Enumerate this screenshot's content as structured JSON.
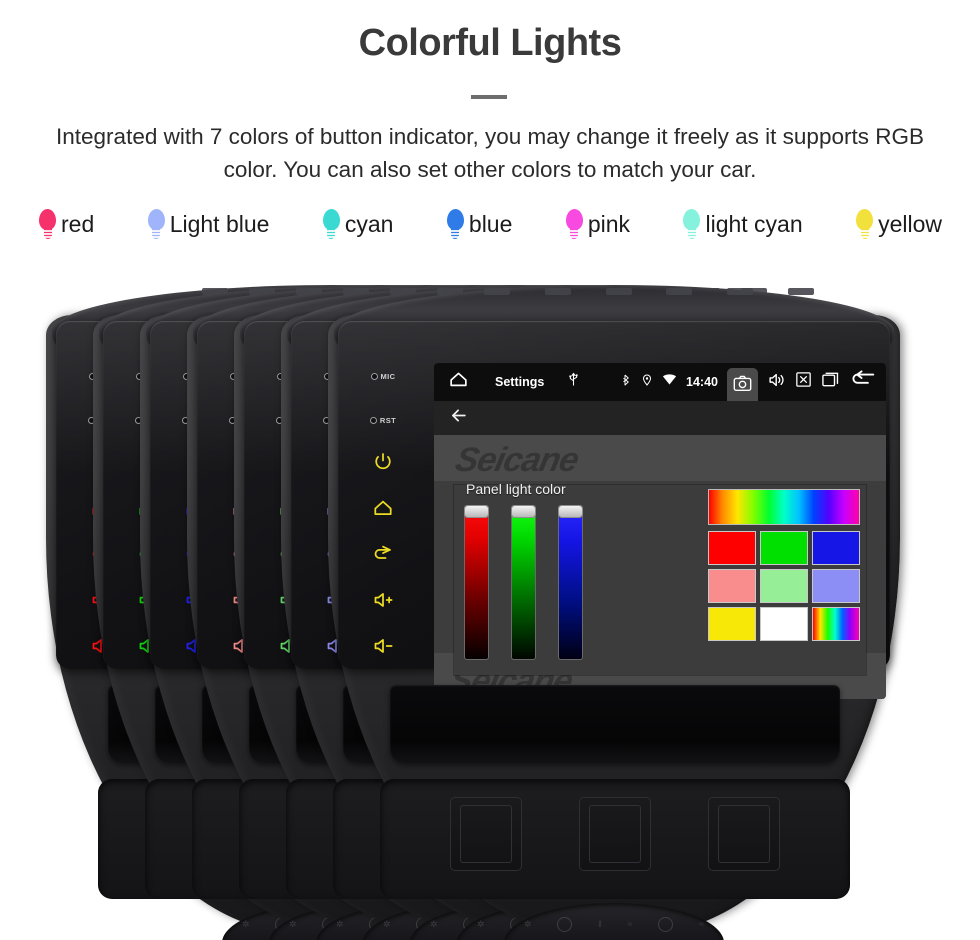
{
  "header": {
    "title": "Colorful Lights",
    "subtitle": "Integrated with 7 colors of button indicator, you may change it freely as it supports RGB color. You can also set other colors to match your car."
  },
  "legend": {
    "items": [
      {
        "label": "red",
        "icon": "bulb-icon",
        "color": "#f5326b"
      },
      {
        "label": "Light blue",
        "icon": "bulb-icon",
        "color": "#9fb4fb"
      },
      {
        "label": "cyan",
        "icon": "bulb-icon",
        "color": "#3ad9d2"
      },
      {
        "label": "blue",
        "icon": "bulb-icon",
        "color": "#2f7ce8"
      },
      {
        "label": "pink",
        "icon": "bulb-icon",
        "color": "#f849e0"
      },
      {
        "label": "light cyan",
        "icon": "bulb-icon",
        "color": "#84f2dd"
      },
      {
        "label": "yellow",
        "icon": "bulb-icon",
        "color": "#f2e13c"
      }
    ]
  },
  "device": {
    "button_panel": {
      "mic_label": "MIC",
      "rst_label": "RST",
      "buttons": [
        {
          "name": "power-button",
          "icon": "power-icon"
        },
        {
          "name": "home-button",
          "icon": "home-icon"
        },
        {
          "name": "back-button",
          "icon": "return-arrow-icon"
        },
        {
          "name": "volume-up-button",
          "icon": "volume-up-icon"
        },
        {
          "name": "volume-down-button",
          "icon": "volume-down-icon"
        }
      ]
    },
    "indicator_colors": [
      "#ff1111",
      "#13d411",
      "#2222ee",
      "#f58a8a",
      "#66d96a",
      "#8a8ae8",
      "#ecdc22"
    ],
    "watermark": "Seicane",
    "climate_marks": [
      "✲",
      "‖",
      "≈",
      "≈"
    ]
  },
  "screen": {
    "statusbar": {
      "home_icon": "home-icon",
      "title": "Settings",
      "usb_icon": "usb-icon",
      "bluetooth_icon": "bluetooth-icon",
      "location_icon": "location-pin-icon",
      "wifi_icon": "wifi-icon",
      "clock": "14:40",
      "camera_icon": "camera-icon",
      "volume_icon": "speaker-icon",
      "close_icon": "close-box-icon",
      "recents_icon": "recents-icon",
      "back_icon": "back-arrow-icon"
    },
    "subbar": {
      "back_icon": "arrow-left-icon"
    },
    "dialog": {
      "title": "Panel light color",
      "sliders": [
        {
          "name": "red-slider",
          "channel": "R",
          "value": 100,
          "color": "#ff0000"
        },
        {
          "name": "green-slider",
          "channel": "G",
          "value": 100,
          "color": "#00ff00"
        },
        {
          "name": "blue-slider",
          "channel": "B",
          "value": 100,
          "color": "#0000ff"
        }
      ],
      "hue_strip": "hue-gradient",
      "swatches": [
        {
          "name": "swatch-red",
          "color": "#ff0000"
        },
        {
          "name": "swatch-green",
          "color": "#00e000"
        },
        {
          "name": "swatch-blue",
          "color": "#1616e6"
        },
        {
          "name": "swatch-salmon",
          "color": "#f98c8c"
        },
        {
          "name": "swatch-light-green",
          "color": "#96ef96"
        },
        {
          "name": "swatch-periwinkle",
          "color": "#8d8df6"
        },
        {
          "name": "swatch-yellow",
          "color": "#f7e808"
        },
        {
          "name": "swatch-white",
          "color": "#ffffff"
        },
        {
          "name": "swatch-rainbow",
          "color": "rainbow"
        }
      ]
    }
  }
}
